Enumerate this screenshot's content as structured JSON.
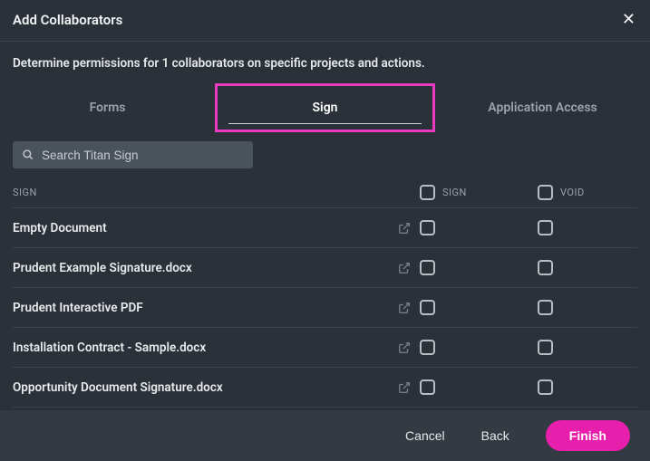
{
  "header": {
    "title": "Add  Collaborators"
  },
  "subtitle": "Determine permissions for 1 collaborators on specific projects and actions.",
  "tabs": {
    "forms": "Forms",
    "sign": "Sign",
    "app_access": "Application Access",
    "active": "sign"
  },
  "search": {
    "placeholder": "Search Titan Sign"
  },
  "table": {
    "header_name": "SIGN",
    "header_sign": "SIGN",
    "header_void": "VOID",
    "rows": [
      {
        "name": "Empty Document"
      },
      {
        "name": "Prudent Example Signature.docx"
      },
      {
        "name": "Prudent Interactive PDF"
      },
      {
        "name": "Installation Contract - Sample.docx"
      },
      {
        "name": "Opportunity Document Signature.docx"
      }
    ]
  },
  "footer": {
    "cancel": "Cancel",
    "back": "Back",
    "finish": "Finish"
  }
}
